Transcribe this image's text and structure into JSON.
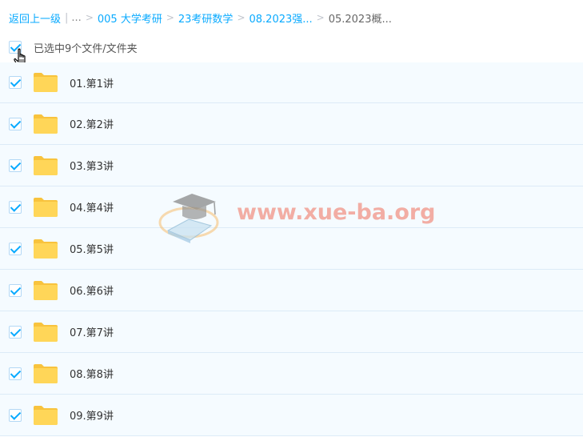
{
  "breadcrumb": {
    "back_label": "返回上一级",
    "ellipsis": "...",
    "items": [
      {
        "label": "005 大学考研"
      },
      {
        "label": "23考研数学"
      },
      {
        "label": "08.2023强..."
      }
    ],
    "current": "05.2023概..."
  },
  "selection": {
    "summary": "已选中9个文件/文件夹",
    "all_checked": true
  },
  "files": [
    {
      "name": "01.第1讲",
      "type": "folder",
      "checked": true
    },
    {
      "name": "02.第2讲",
      "type": "folder",
      "checked": true
    },
    {
      "name": "03.第3讲",
      "type": "folder",
      "checked": true
    },
    {
      "name": "04.第4讲",
      "type": "folder",
      "checked": true
    },
    {
      "name": "05.第5讲",
      "type": "folder",
      "checked": true
    },
    {
      "name": "06.第6讲",
      "type": "folder",
      "checked": true
    },
    {
      "name": "07.第7讲",
      "type": "folder",
      "checked": true
    },
    {
      "name": "08.第8讲",
      "type": "folder",
      "checked": true
    },
    {
      "name": "09.第9讲",
      "type": "folder",
      "checked": true
    }
  ],
  "icons": {
    "checkbox": "checkbox-checked-icon",
    "folder": "folder-icon",
    "cursor": "hand-cursor-icon",
    "watermark_logo": "graduation-cap-book-icon"
  },
  "watermark": {
    "text": "www.xue-ba.org"
  },
  "colors": {
    "accent": "#09aaff",
    "folder": "#ffd24d",
    "row_bg": "#f5fbff",
    "watermark_text": "#ee6e5a"
  }
}
